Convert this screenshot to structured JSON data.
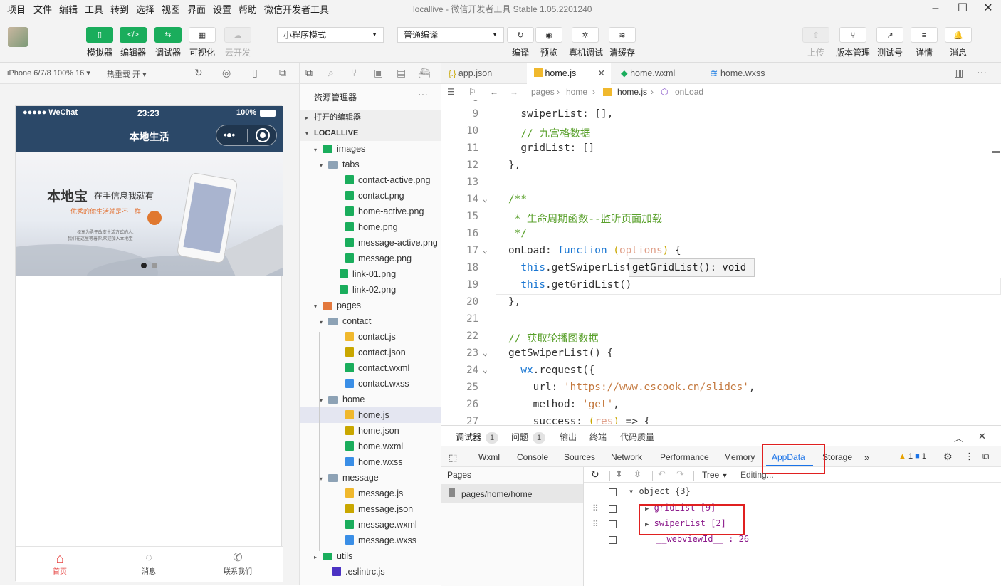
{
  "menubar": {
    "items": [
      "项目",
      "文件",
      "编辑",
      "工具",
      "转到",
      "选择",
      "视图",
      "界面",
      "设置",
      "帮助",
      "微信开发者工具"
    ],
    "title": "locallive - 微信开发者工具 Stable 1.05.2201240"
  },
  "toolbar": {
    "simulator": "模拟器",
    "editor": "编辑器",
    "debugger": "调试器",
    "visual": "可视化",
    "cloud": "云开发",
    "mode": "小程序模式",
    "compile": "普通编译",
    "compile_btn": "编译",
    "preview": "预览",
    "realdebug": "真机调试",
    "clearcache": "清缓存",
    "upload": "上传",
    "version": "版本管理",
    "testid": "测试号",
    "details": "详情",
    "messages": "消息"
  },
  "simbar": {
    "device": "iPhone 6/7/8 100% 16",
    "hotreload": "热重载 开"
  },
  "phone": {
    "carrier": "●●●●● WeChat",
    "time": "23:23",
    "battery": "100%",
    "nav_title": "本地生活",
    "banner_title": "本地宝",
    "banner_title2": "在手信息我就有",
    "banner_sub": "优秀的你生活就是不一样",
    "banner_small1": "择东为勇于改变生活方式的人,",
    "banner_small2": "我们在这里等着你,欢迎加入本地宝",
    "tabs": [
      {
        "label": "首页",
        "active": true
      },
      {
        "label": "消息",
        "active": false
      },
      {
        "label": "联系我们",
        "active": false
      }
    ]
  },
  "explorer": {
    "title": "资源管理器",
    "open_editors": "打开的编辑器",
    "project": "LOCALLIVE",
    "rows": [
      {
        "label": "images",
        "depth": 1,
        "type": "folder-img",
        "caret": "▾"
      },
      {
        "label": "tabs",
        "depth": 2,
        "type": "folder",
        "caret": "▾"
      },
      {
        "label": "contact-active.png",
        "depth": 3,
        "type": "png"
      },
      {
        "label": "contact.png",
        "depth": 3,
        "type": "png"
      },
      {
        "label": "home-active.png",
        "depth": 3,
        "type": "png"
      },
      {
        "label": "home.png",
        "depth": 3,
        "type": "png"
      },
      {
        "label": "message-active.png",
        "depth": 3,
        "type": "png"
      },
      {
        "label": "message.png",
        "depth": 3,
        "type": "png"
      },
      {
        "label": "link-01.png",
        "depth": 2,
        "type": "png"
      },
      {
        "label": "link-02.png",
        "depth": 2,
        "type": "png"
      },
      {
        "label": "pages",
        "depth": 1,
        "type": "folder-pages",
        "caret": "▾"
      },
      {
        "label": "contact",
        "depth": 2,
        "type": "folder",
        "caret": "▾"
      },
      {
        "label": "contact.js",
        "depth": 3,
        "type": "js"
      },
      {
        "label": "contact.json",
        "depth": 3,
        "type": "json"
      },
      {
        "label": "contact.wxml",
        "depth": 3,
        "type": "wxml"
      },
      {
        "label": "contact.wxss",
        "depth": 3,
        "type": "wxss"
      },
      {
        "label": "home",
        "depth": 2,
        "type": "folder",
        "caret": "▾"
      },
      {
        "label": "home.js",
        "depth": 3,
        "type": "js",
        "active": true
      },
      {
        "label": "home.json",
        "depth": 3,
        "type": "json"
      },
      {
        "label": "home.wxml",
        "depth": 3,
        "type": "wxml"
      },
      {
        "label": "home.wxss",
        "depth": 3,
        "type": "wxss"
      },
      {
        "label": "message",
        "depth": 2,
        "type": "folder",
        "caret": "▾"
      },
      {
        "label": "message.js",
        "depth": 3,
        "type": "js"
      },
      {
        "label": "message.json",
        "depth": 3,
        "type": "json"
      },
      {
        "label": "message.wxml",
        "depth": 3,
        "type": "wxml"
      },
      {
        "label": "message.wxss",
        "depth": 3,
        "type": "wxss"
      },
      {
        "label": "utils",
        "depth": 1,
        "type": "folder-utils",
        "caret": "▸"
      },
      {
        "label": ".eslintrc.js",
        "depth": 1,
        "type": "eslint"
      }
    ]
  },
  "editor": {
    "tabs": [
      {
        "label": "app.json",
        "icon": "{.}"
      },
      {
        "label": "home.js",
        "icon": "JS",
        "active": true
      },
      {
        "label": "home.wxml",
        "icon": "◇"
      },
      {
        "label": "home.wxss",
        "icon": "S"
      }
    ],
    "crumbs": [
      "pages",
      "home",
      "home.js",
      "onLoad"
    ],
    "lines": [
      {
        "n": "9",
        "html": "  swiperList: [],"
      },
      {
        "n": "10",
        "html": "  // 九宫格数据"
      },
      {
        "n": "11",
        "html": "  gridList: []"
      },
      {
        "n": "12",
        "html": "},"
      },
      {
        "n": "13",
        "html": ""
      },
      {
        "n": "14",
        "html": "/**"
      },
      {
        "n": "15",
        "html": " * 生命周期函数--监听页面加载"
      },
      {
        "n": "16",
        "html": " */"
      },
      {
        "n": "17",
        "html": "onLoad: function (options) {"
      },
      {
        "n": "18",
        "html": "  this.getSwiperList()"
      },
      {
        "n": "19",
        "html": "  this.getGridList()"
      },
      {
        "n": "20",
        "html": "},"
      },
      {
        "n": "21",
        "html": ""
      },
      {
        "n": "22",
        "html": "// 获取轮播图数据"
      },
      {
        "n": "23",
        "html": "getSwiperList() {"
      },
      {
        "n": "24",
        "html": "  wx.request({"
      },
      {
        "n": "25",
        "html": "    url: 'https://www.escook.cn/slides',"
      },
      {
        "n": "26",
        "html": "    method: 'get',"
      },
      {
        "n": "27",
        "html": "    success: (res) => {"
      }
    ],
    "hint": "getGridList(): void"
  },
  "devtools": {
    "tab_debugger": "调试器",
    "tab_debugger_count": "1",
    "tab_issues": "问题",
    "tab_issues_count": "1",
    "tab_output": "输出",
    "tab_terminal": "终端",
    "tab_quality": "代码质量",
    "panels": [
      "Wxml",
      "Console",
      "Sources",
      "Network",
      "Performance",
      "Memory",
      "AppData",
      "Storage"
    ],
    "warn": "1",
    "info": "1",
    "pages_label": "Pages",
    "page_item": "pages/home/home",
    "view": "Tree",
    "editing": "Editing...",
    "obj": "object {3}",
    "item1": "gridList [9]",
    "item2": "swiperList [2]",
    "item3": "__webviewId__ : 26"
  },
  "colors": {
    "green": "#1aad5c",
    "navy": "#2b4868",
    "red_box": "#e02020",
    "tab_active": "#e64340"
  }
}
